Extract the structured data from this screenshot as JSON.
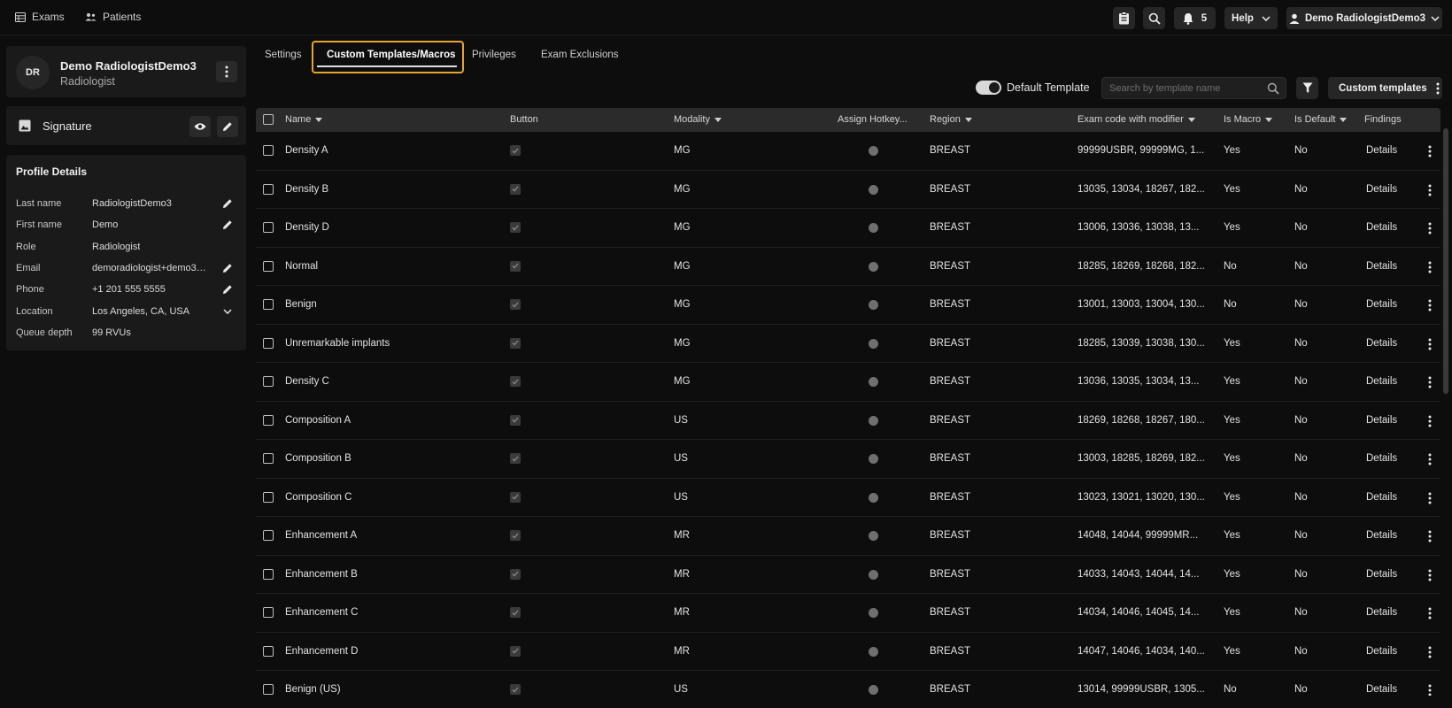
{
  "nav": {
    "exams": "Exams",
    "patients": "Patients"
  },
  "topbar": {
    "notification_count": "5",
    "help": "Help",
    "user": "Demo RadiologistDemo3"
  },
  "profile": {
    "initials": "DR",
    "name": "Demo RadiologistDemo3",
    "role": "Radiologist",
    "signature_label": "Signature",
    "details_title": "Profile Details",
    "fields": [
      {
        "label": "Last name",
        "value": "RadiologistDemo3",
        "action": "edit"
      },
      {
        "label": "First name",
        "value": "Demo",
        "action": "edit"
      },
      {
        "label": "Role",
        "value": "Radiologist",
        "action": ""
      },
      {
        "label": "Email",
        "value": "demoradiologist+demo3@...",
        "action": "edit"
      },
      {
        "label": "Phone",
        "value": "+1 201 555 5555",
        "action": "edit"
      },
      {
        "label": "Location",
        "value": "Los Angeles, CA, USA",
        "action": "dropdown"
      },
      {
        "label": "Queue depth",
        "value": "99 RVUs",
        "action": ""
      }
    ]
  },
  "tabs": [
    {
      "label": "Settings",
      "active": false
    },
    {
      "label": "Custom Templates/Macros",
      "active": true
    },
    {
      "label": "Privileges",
      "active": false
    },
    {
      "label": "Exam Exclusions",
      "active": false
    }
  ],
  "toolbar": {
    "default_template_label": "Default Template",
    "default_template_on": true,
    "search_placeholder": "Search by template name",
    "custom_templates_label": "Custom templates"
  },
  "table": {
    "columns": {
      "name": "Name",
      "button": "Button",
      "modality": "Modality",
      "hotkey": "Assign Hotkey...",
      "region": "Region",
      "exam_code": "Exam code with modifier",
      "is_macro": "Is Macro",
      "is_default": "Is Default",
      "findings": "Findings"
    },
    "rows": [
      {
        "name": "Density A",
        "modality": "MG",
        "region": "BREAST",
        "exam_code": "99999USBR, 99999MG, 1...",
        "is_macro": "Yes",
        "is_default": "No",
        "findings": "Details"
      },
      {
        "name": "Density B",
        "modality": "MG",
        "region": "BREAST",
        "exam_code": "13035, 13034, 18267, 182...",
        "is_macro": "Yes",
        "is_default": "No",
        "findings": "Details"
      },
      {
        "name": "Density D",
        "modality": "MG",
        "region": "BREAST",
        "exam_code": "13006, 13036, 13038, 13...",
        "is_macro": "Yes",
        "is_default": "No",
        "findings": "Details"
      },
      {
        "name": "Normal",
        "modality": "MG",
        "region": "BREAST",
        "exam_code": "18285, 18269, 18268, 182...",
        "is_macro": "No",
        "is_default": "No",
        "findings": "Details"
      },
      {
        "name": "Benign",
        "modality": "MG",
        "region": "BREAST",
        "exam_code": "13001, 13003, 13004, 130...",
        "is_macro": "No",
        "is_default": "No",
        "findings": "Details"
      },
      {
        "name": "Unremarkable implants",
        "modality": "MG",
        "region": "BREAST",
        "exam_code": "18285, 13039, 13038, 130...",
        "is_macro": "Yes",
        "is_default": "No",
        "findings": "Details"
      },
      {
        "name": "Density C",
        "modality": "MG",
        "region": "BREAST",
        "exam_code": "13036, 13035, 13034, 13...",
        "is_macro": "Yes",
        "is_default": "No",
        "findings": "Details"
      },
      {
        "name": "Composition A",
        "modality": "US",
        "region": "BREAST",
        "exam_code": "18269, 18268, 18267, 180...",
        "is_macro": "Yes",
        "is_default": "No",
        "findings": "Details"
      },
      {
        "name": "Composition B",
        "modality": "US",
        "region": "BREAST",
        "exam_code": "13003, 18285, 18269, 182...",
        "is_macro": "Yes",
        "is_default": "No",
        "findings": "Details"
      },
      {
        "name": "Composition C",
        "modality": "US",
        "region": "BREAST",
        "exam_code": "13023, 13021, 13020, 130...",
        "is_macro": "Yes",
        "is_default": "No",
        "findings": "Details"
      },
      {
        "name": "Enhancement A",
        "modality": "MR",
        "region": "BREAST",
        "exam_code": "14048, 14044, 99999MR...",
        "is_macro": "Yes",
        "is_default": "No",
        "findings": "Details"
      },
      {
        "name": "Enhancement B",
        "modality": "MR",
        "region": "BREAST",
        "exam_code": "14033, 14043, 14044, 14...",
        "is_macro": "Yes",
        "is_default": "No",
        "findings": "Details"
      },
      {
        "name": "Enhancement C",
        "modality": "MR",
        "region": "BREAST",
        "exam_code": "14034, 14046, 14045, 14...",
        "is_macro": "Yes",
        "is_default": "No",
        "findings": "Details"
      },
      {
        "name": "Enhancement D",
        "modality": "MR",
        "region": "BREAST",
        "exam_code": "14047, 14046, 14034, 140...",
        "is_macro": "Yes",
        "is_default": "No",
        "findings": "Details"
      },
      {
        "name": "Benign (US)",
        "modality": "US",
        "region": "BREAST",
        "exam_code": "13014, 99999USBR, 1305...",
        "is_macro": "No",
        "is_default": "No",
        "findings": "Details"
      }
    ]
  },
  "colors": {
    "focus_ring": "#e8a230",
    "background": "#0d0d0d",
    "panel": "#1a1a1a",
    "header": "#2b2b2b"
  }
}
